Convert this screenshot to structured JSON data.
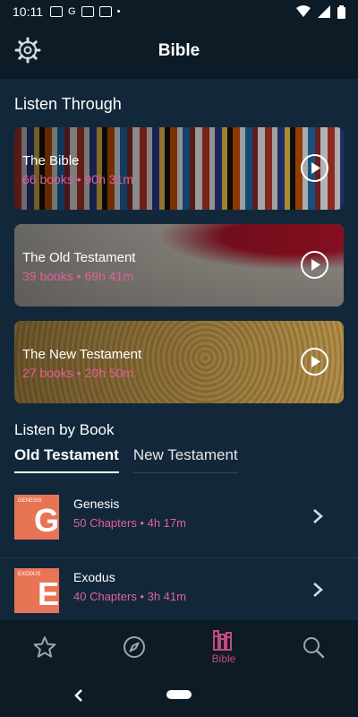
{
  "status_bar": {
    "time": "10:11"
  },
  "header": {
    "title": "Bible"
  },
  "listen_through": {
    "title": "Listen Through",
    "cards": [
      {
        "title": "The Bible",
        "subtitle": "66 books • 90h 31m"
      },
      {
        "title": "The Old Testament",
        "subtitle": "39 books • 69h 41m"
      },
      {
        "title": "The New Testament",
        "subtitle": "27 books • 20h 50m"
      }
    ]
  },
  "listen_by_book": {
    "title": "Listen by Book",
    "tabs": [
      "Old Testament",
      "New Testament"
    ],
    "books": [
      {
        "cover_label": "GENESIS",
        "cover_letter": "G",
        "title": "Genesis",
        "subtitle": "50 Chapters • 4h 17m"
      },
      {
        "cover_label": "EXODUS",
        "cover_letter": "E",
        "title": "Exodus",
        "subtitle": "40 Chapters • 3h 41m"
      }
    ]
  },
  "bottom_nav": {
    "active_label": "Bible"
  },
  "colors": {
    "accent": "#e0609a",
    "background": "#12283a",
    "cover": "#e87456"
  }
}
